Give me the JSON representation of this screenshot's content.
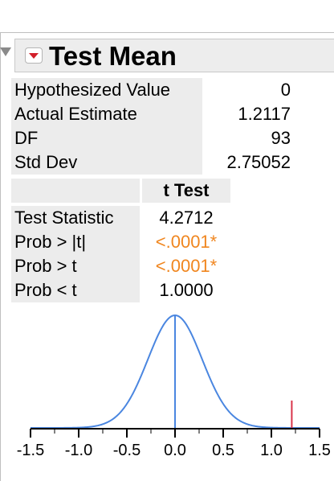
{
  "report": {
    "title": "Test Mean"
  },
  "summary_rows": [
    {
      "label": "Hypothesized Value",
      "value": "0"
    },
    {
      "label": "Actual Estimate",
      "value": "1.2117"
    },
    {
      "label": "DF",
      "value": "93"
    },
    {
      "label": "Std Dev",
      "value": "2.75052"
    }
  ],
  "ttest": {
    "header": "t Test",
    "rows": [
      {
        "label": "Test Statistic",
        "value": "4.2712",
        "highlight": false
      },
      {
        "label": "Prob > |t|",
        "value": "<.0001*",
        "highlight": true
      },
      {
        "label": "Prob > t",
        "value": "<.0001*",
        "highlight": true
      },
      {
        "label": "Prob < t",
        "value": "1.0000",
        "highlight": false
      }
    ],
    "highlight_color": "#f0861f"
  },
  "chart_data": {
    "type": "line",
    "curve": "t-distribution density",
    "df": 93,
    "scale": 0.2837,
    "hypothesized_mean": 0,
    "estimate": 1.2117,
    "xlim": [
      -1.5,
      1.5
    ],
    "x_ticks": [
      "-1.5",
      "-1.0",
      "-0.5",
      "0.0",
      "0.5",
      "1.0",
      "1.5"
    ],
    "x_tick_values": [
      -1.5,
      -1.0,
      -0.5,
      0.0,
      0.5,
      1.0,
      1.5
    ],
    "curve_color": "#4a86e0",
    "estimate_color": "#d9344a"
  }
}
